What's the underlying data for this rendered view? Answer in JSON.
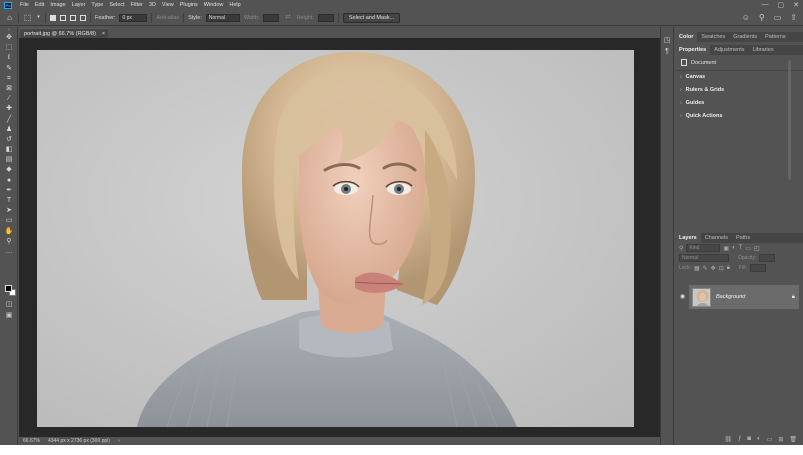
{
  "app": {
    "logo": "Ps"
  },
  "menu": [
    "File",
    "Edit",
    "Image",
    "Layer",
    "Type",
    "Select",
    "Filter",
    "3D",
    "View",
    "Plugins",
    "Window",
    "Help"
  ],
  "window_controls": [
    "—",
    "▢",
    "✕"
  ],
  "options_bar": {
    "feather_label": "Feather:",
    "feather_value": "0 px",
    "antialias_label": "Anti-alias",
    "style_label": "Style:",
    "style_value": "Normal",
    "width_label": "Width:",
    "height_label": "Height:",
    "select_mask_label": "Select and Mask..."
  },
  "document": {
    "tab_title": "portrait.jpg @ 66.7% (RGB/8)",
    "tab_close": "×",
    "zoom": "66.67%",
    "info": "4344 px x 2736 px (300 ppi)",
    "status_arrow": "›"
  },
  "panels": {
    "color_tabs": [
      "Color",
      "Swatches",
      "Gradients",
      "Patterns"
    ],
    "properties_tabs": [
      "Properties",
      "Adjustments",
      "Libraries"
    ],
    "properties": {
      "document_label": "Document",
      "sections": [
        "Canvas",
        "Rulers & Grids",
        "Guides",
        "Quick Actions"
      ]
    },
    "layers_tabs": [
      "Layers",
      "Channels",
      "Paths"
    ],
    "layers": {
      "kind_placeholder": "Kind",
      "blend_mode": "Normal",
      "opacity_label": "Opacity:",
      "lock_label": "Lock:",
      "fill_label": "Fill:",
      "items": [
        {
          "name": "Background"
        }
      ]
    }
  },
  "colors": {
    "accent": "#31a8ff",
    "ui_bg": "#535353",
    "canvas_bg": "#282828"
  }
}
